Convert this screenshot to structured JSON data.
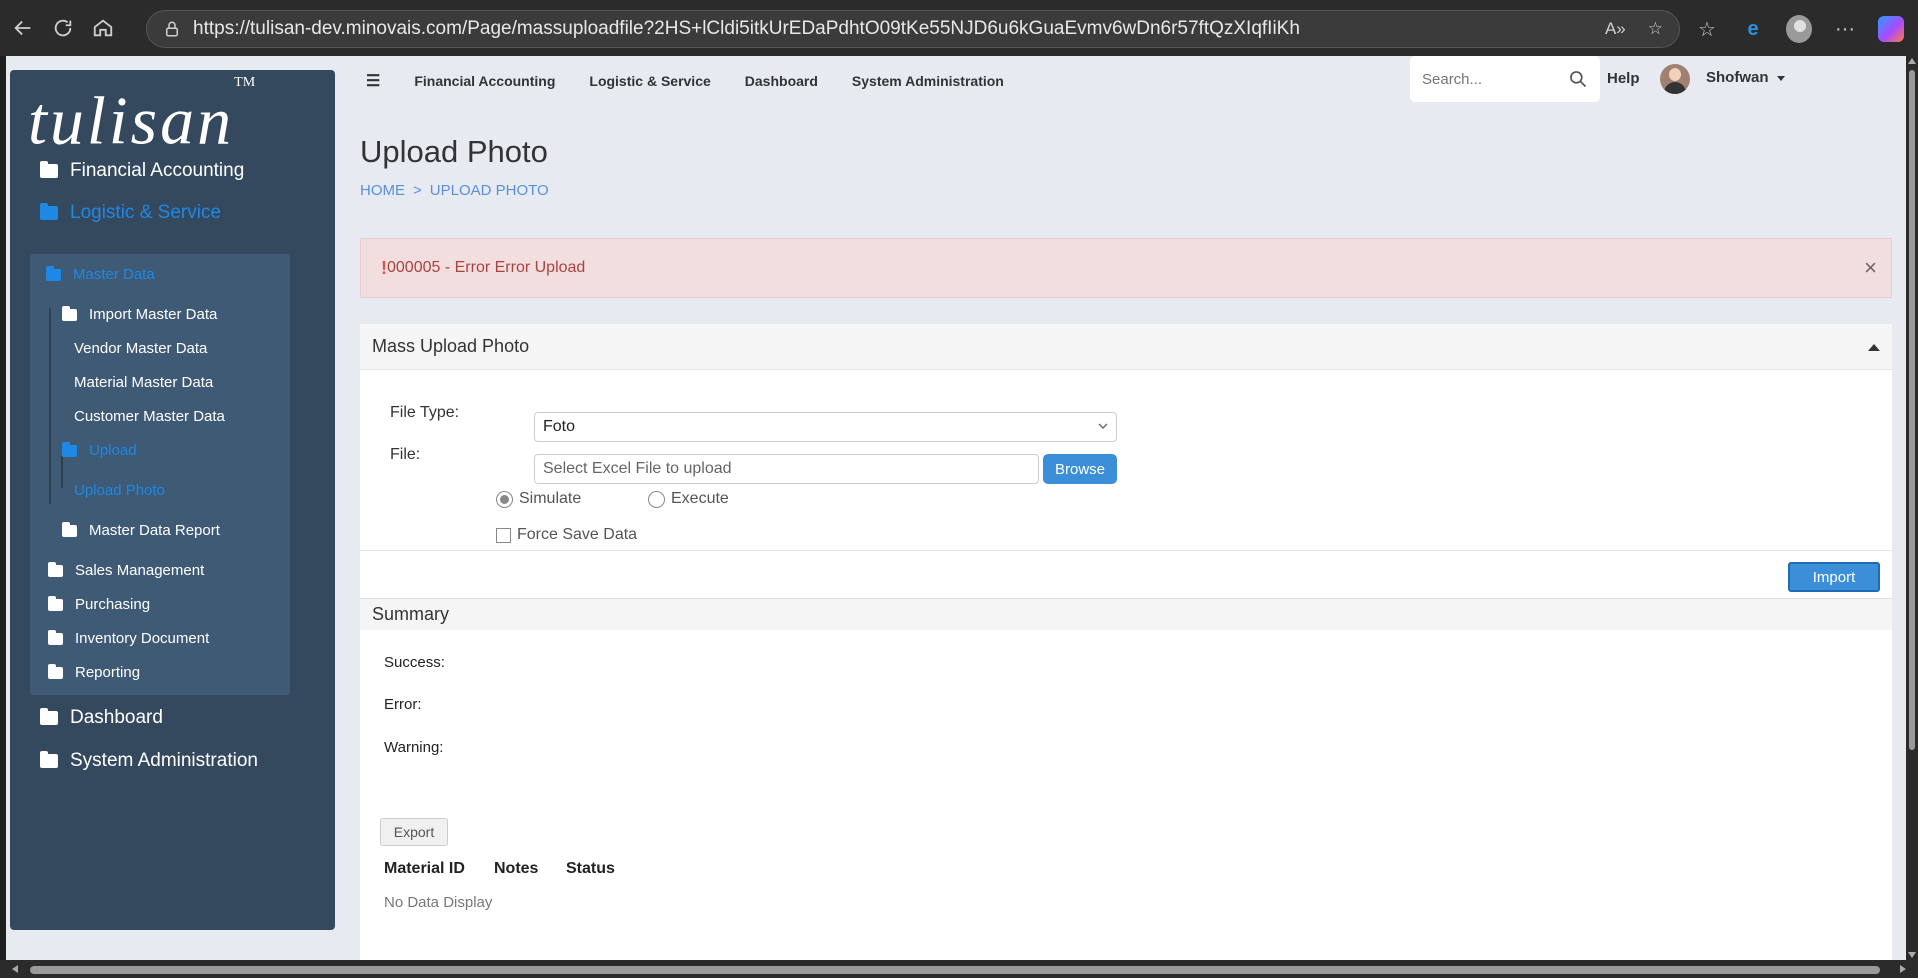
{
  "browser": {
    "url": "https://tulisan-dev.minovais.com/Page/massuploadfile?2HS+lCldi5itkUrEDaPdhtO09tKe55NJD6u6kGuaEvmv6wDn6r57ftQzXIqfIiKh"
  },
  "logo": {
    "text": "tulisan",
    "tm": "TM"
  },
  "sidebar": {
    "top_items": [
      {
        "label": "Financial Accounting"
      },
      {
        "label": "Logistic & Service"
      },
      {
        "label": "Dashboard"
      },
      {
        "label": "System Administration"
      }
    ],
    "logistic_items": [
      {
        "label": "Master Data"
      },
      {
        "label": "Import Master Data"
      },
      {
        "label": "Vendor Master Data"
      },
      {
        "label": "Material Master Data"
      },
      {
        "label": "Customer Master Data"
      },
      {
        "label": "Upload"
      },
      {
        "label": "Upload Photo"
      },
      {
        "label": "Master Data Report"
      },
      {
        "label": "Sales Management"
      },
      {
        "label": "Purchasing"
      },
      {
        "label": "Inventory Document"
      },
      {
        "label": "Reporting"
      }
    ]
  },
  "topnav": {
    "items": [
      "Financial Accounting",
      "Logistic & Service",
      "Dashboard",
      "System Administration"
    ],
    "search_placeholder": "Search...",
    "help": "Help",
    "user": "Shofwan"
  },
  "page": {
    "title": "Upload Photo",
    "breadcrumb": {
      "home": "HOME",
      "sep": ">",
      "current": "UPLOAD PHOTO"
    }
  },
  "alert": {
    "icon": "!",
    "message": "000005 - Error Error Upload",
    "close": "×"
  },
  "upload_panel": {
    "title": "Mass Upload Photo",
    "file_type_label": "File Type:",
    "file_type_value": "Foto",
    "file_label": "File:",
    "file_placeholder": "Select Excel File to upload",
    "browse": "Browse",
    "simulate": "Simulate",
    "execute": "Execute",
    "force_save": "Force Save Data",
    "import": "Import"
  },
  "summary": {
    "title": "Summary",
    "success_label": "Success:",
    "error_label": "Error:",
    "warning_label": "Warning:",
    "export": "Export",
    "columns": [
      "Material ID",
      "Notes",
      "Status"
    ],
    "empty": "No Data Display"
  },
  "colors": {
    "sidebar_bg": "#34495e",
    "accent": "#1e88e5",
    "alert_bg": "#f2dede"
  }
}
